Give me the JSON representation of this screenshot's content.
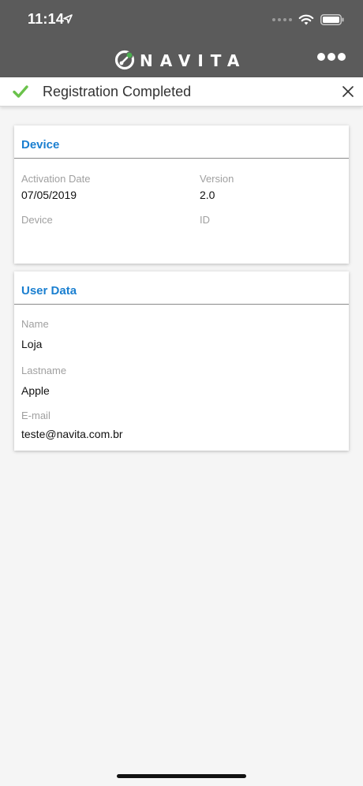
{
  "status_bar": {
    "time": "11:14",
    "icons": [
      "location-arrow-icon",
      "signal-icon",
      "wifi-icon",
      "battery-icon"
    ]
  },
  "app_bar": {
    "logo_text": "NAVITA",
    "menu_icon": "more-dots-icon",
    "colors": {
      "background": "#5b5b5b",
      "logo_green": "#4caf50"
    }
  },
  "notice": {
    "text": "Registration Completed",
    "check_color": "#6ac24b",
    "icons": [
      "check-icon",
      "close-icon"
    ]
  },
  "device_card": {
    "title": "Device",
    "activation_date_label": "Activation Date",
    "activation_date_value": "07/05/2019",
    "version_label": "Version",
    "version_value": "2.0",
    "device_label": "Device",
    "id_label": "ID"
  },
  "user_card": {
    "title": "User Data",
    "name_label": "Name",
    "name_value": "Loja",
    "lastname_label": "Lastname",
    "lastname_value": "Apple",
    "email_label": "E-mail",
    "email_value": "teste@navita.com.br"
  },
  "accent_color": "#1a7fd0"
}
